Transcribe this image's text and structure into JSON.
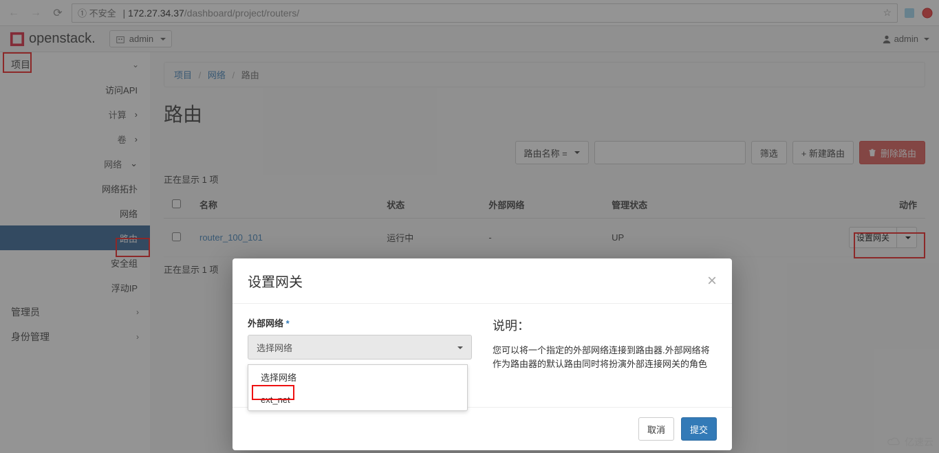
{
  "browser": {
    "url_insecure_label": "① 不安全",
    "url_host": "172.27.34.37",
    "url_path": "/dashboard/project/routers/"
  },
  "header": {
    "brand": "openstack.",
    "project_label": "admin",
    "user_label": "admin"
  },
  "sidebar": {
    "project": "项目",
    "access_api": "访问API",
    "compute": "计算",
    "volume": "卷",
    "network": "网络",
    "net_topo": "网络拓扑",
    "net_networks": "网络",
    "net_routers": "路由",
    "net_secgroups": "安全组",
    "net_floatip": "浮动IP",
    "admin": "管理员",
    "identity": "身份管理"
  },
  "breadcrumb": {
    "a": "项目",
    "b": "网络",
    "c": "路由"
  },
  "page_title": "路由",
  "toolbar": {
    "filter_col": "路由名称 =",
    "filter_btn": "筛选",
    "create_btn": "+ 新建路由",
    "delete_btn": "删除路由"
  },
  "table": {
    "count_top": "正在显示 1 项",
    "count_bottom": "正在显示 1 项",
    "headers": {
      "name": "名称",
      "status": "状态",
      "extnet": "外部网络",
      "admin": "管理状态",
      "actions": "动作"
    },
    "row": {
      "name": "router_100_101",
      "status": "运行中",
      "extnet": "-",
      "admin": "UP",
      "action_label": "设置网关"
    }
  },
  "modal": {
    "title": "设置网关",
    "field_label": "外部网络",
    "select_placeholder": "选择网络",
    "options": {
      "opt0": "选择网络",
      "opt1": "ext_net"
    },
    "desc_title": "说明：",
    "desc_body": "您可以将一个指定的外部网络连接到路由器.外部网络将作为路由器的默认路由同时将扮演外部连接网关的角色",
    "cancel": "取消",
    "submit": "提交"
  },
  "watermark": "亿速云"
}
